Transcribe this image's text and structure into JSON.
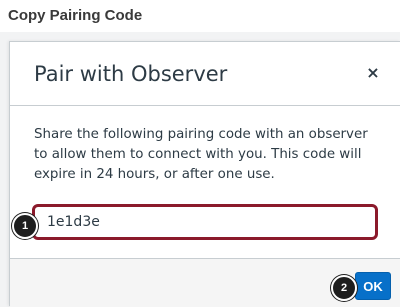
{
  "page": {
    "heading": "Copy Pairing Code"
  },
  "dialog": {
    "title": "Pair with Observer",
    "close_glyph": "×",
    "body_text": "Share the following pairing code with an observer to allow them to connect with you. This code will expire in 24 hours, or after one use.",
    "pairing_code": "1e1d3e",
    "ok_label": "OK"
  },
  "callouts": {
    "one": "1",
    "two": "2"
  },
  "colors": {
    "accent": "#0770c9",
    "highlight_border": "#8b1a2b"
  }
}
